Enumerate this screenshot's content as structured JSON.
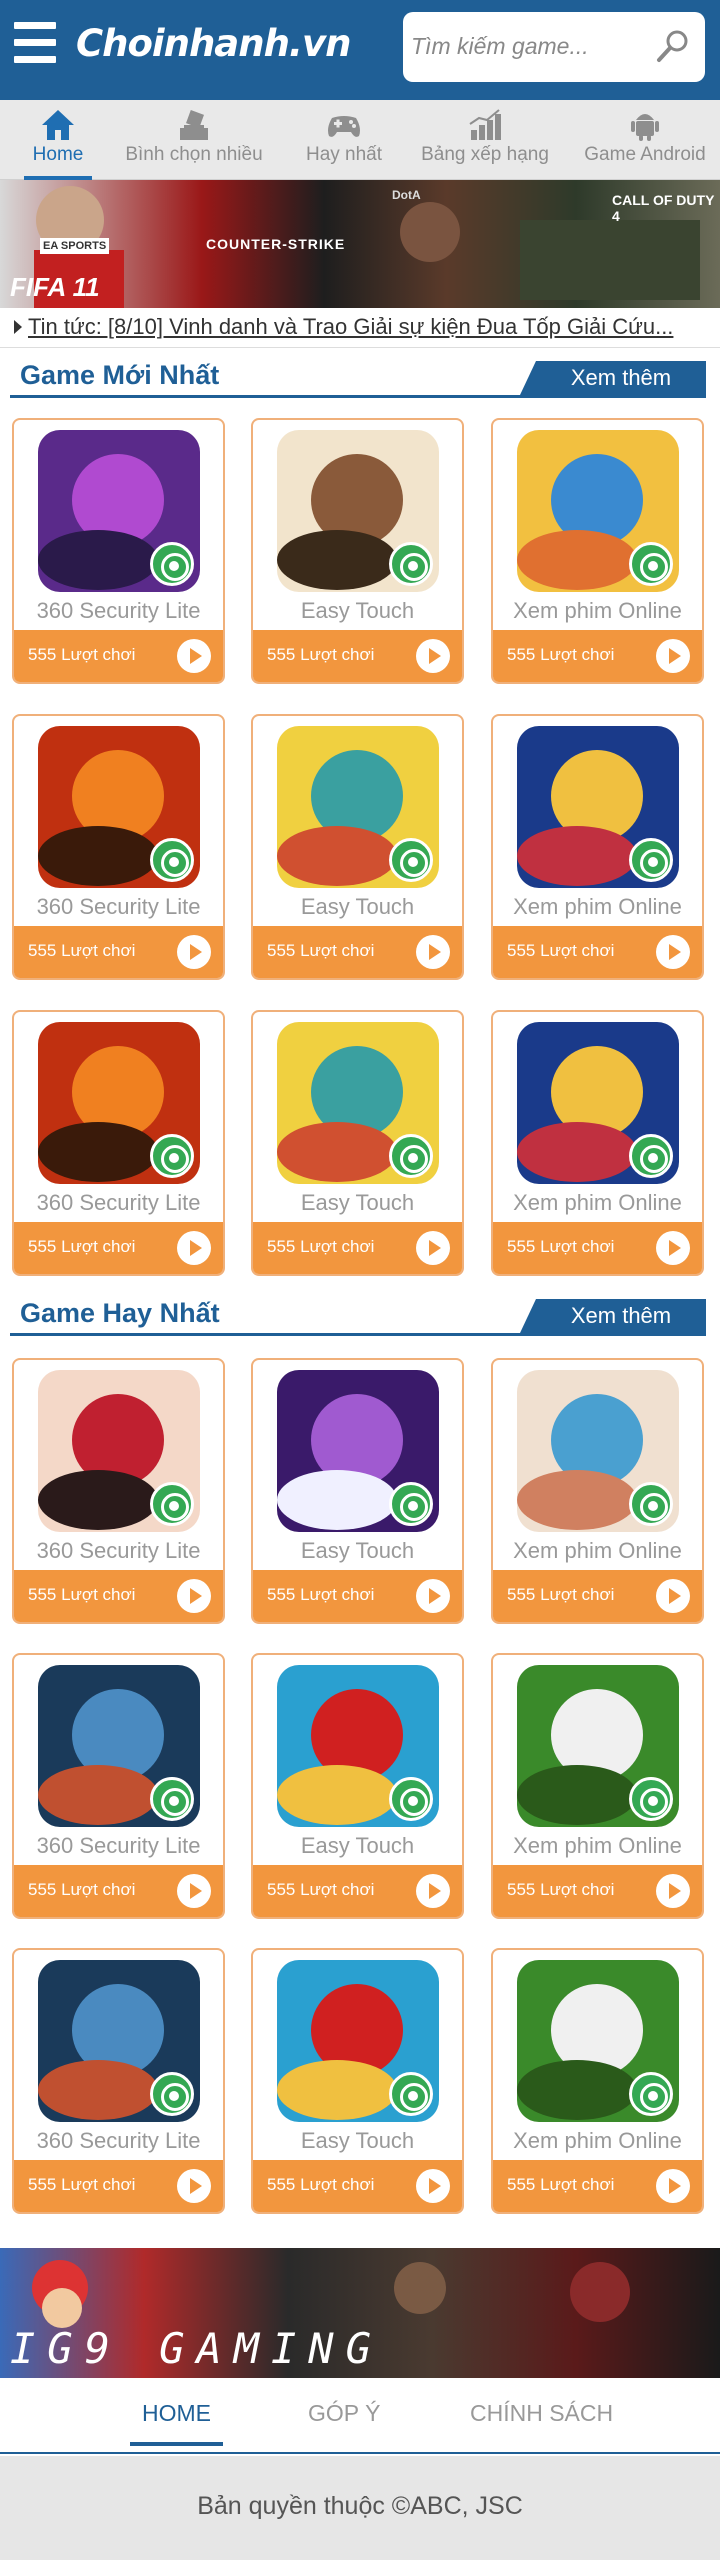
{
  "header": {
    "logo": "Choinhanh.vn",
    "search_placeholder": "Tìm kiếm game..."
  },
  "nav": {
    "items": [
      {
        "label": "Home",
        "icon": "home-icon"
      },
      {
        "label": "Bình chọn nhiều",
        "icon": "vote-icon"
      },
      {
        "label": "Hay nhất",
        "icon": "gamepad-icon"
      },
      {
        "label": "Bảng xếp hạng",
        "icon": "chart-icon"
      },
      {
        "label": "Game Android",
        "icon": "android-icon"
      }
    ],
    "active_index": 0
  },
  "banner": {
    "texts": [
      "FIFA 11",
      "COUNTER-STRIKE",
      "CALL OF DUTY 4",
      "EA SPORTS",
      "DotA"
    ]
  },
  "ticker": {
    "text": "Tin tức: [8/10] Vinh danh và Trao Giải sự kiện Đua Tốp Giải Cứu..."
  },
  "sections": [
    {
      "title": "Game Mới Nhất",
      "more_label": "Xem thêm",
      "cards": [
        {
          "name": "360 Security Lite",
          "plays": "555 Lượt chơi"
        },
        {
          "name": "Easy Touch",
          "plays": "555 Lượt chơi"
        },
        {
          "name": "Xem phim Online",
          "plays": "555 Lượt chơi"
        },
        {
          "name": "360 Security Lite",
          "plays": "555 Lượt chơi"
        },
        {
          "name": "Easy Touch",
          "plays": "555 Lượt chơi"
        },
        {
          "name": "Xem phim Online",
          "plays": "555 Lượt chơi"
        },
        {
          "name": "360 Security Lite",
          "plays": "555 Lượt chơi"
        },
        {
          "name": "Easy Touch",
          "plays": "555 Lượt chơi"
        },
        {
          "name": "Xem phim Online",
          "plays": "555 Lượt chơi"
        }
      ]
    },
    {
      "title": "Game Hay Nhất",
      "more_label": "Xem thêm",
      "cards": [
        {
          "name": "360 Security Lite",
          "plays": "555 Lượt chơi"
        },
        {
          "name": "Easy Touch",
          "plays": "555 Lượt chơi"
        },
        {
          "name": "Xem phim Online",
          "plays": "555 Lượt chơi"
        },
        {
          "name": "360 Security Lite",
          "plays": "555 Lượt chơi"
        },
        {
          "name": "Easy Touch",
          "plays": "555 Lượt chơi"
        },
        {
          "name": "Xem phim Online",
          "plays": "555 Lượt chơi"
        },
        {
          "name": "360 Security Lite",
          "plays": "555 Lượt chơi"
        },
        {
          "name": "Easy Touch",
          "plays": "555 Lượt chơi"
        },
        {
          "name": "Xem phim Online",
          "plays": "555 Lượt chơi"
        }
      ]
    }
  ],
  "bottom_banner": {
    "text": "IG9 GAMING"
  },
  "footer": {
    "links": [
      "HOME",
      "GÓP Ý",
      "CHÍNH SÁCH"
    ],
    "active_index": 0,
    "copyright": "Bản quyền thuộc ©ABC, JSC"
  },
  "colors": {
    "primary": "#1f5f96",
    "accent": "#f2963e",
    "card_border": "#f0b07a"
  }
}
